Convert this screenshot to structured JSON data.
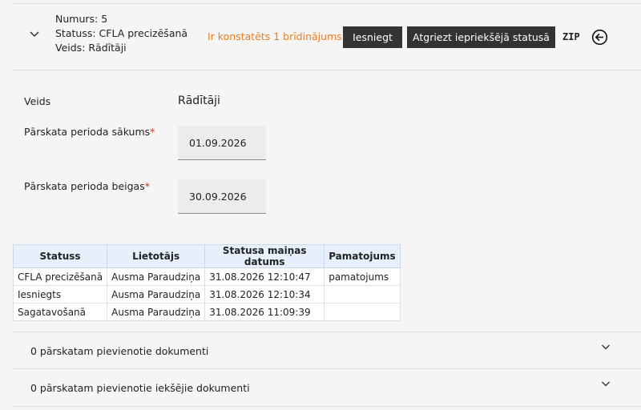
{
  "header": {
    "number": "Numurs: 5",
    "status": "Statuss: CFLA precizēšanā",
    "type": "Veids: Rādītāji",
    "warning": "Ir konstatēts 1 brīdinājums",
    "submit_label": "Iesniegt",
    "revert_label": "Atgriezt iepriekšējā statusā",
    "zip_label": "ZIP"
  },
  "form": {
    "type_label": "Veids",
    "type_value": "Rādītāji",
    "start_label": "Pārskata perioda sākums",
    "start_value": "01.09.2026",
    "end_label": "Pārskata perioda beigas",
    "end_value": "30.09.2026",
    "required_mark": "*"
  },
  "status_table": {
    "columns": [
      "Statuss",
      "Lietotājs",
      "Statusa maiņas datums",
      "Pamatojums"
    ],
    "rows": [
      [
        "CFLA precizēšanā",
        "Ausma Paraudziņa",
        "31.08.2026 12:10:47",
        "pamatojums"
      ],
      [
        "Iesniegts",
        "Ausma Paraudziņa",
        "31.08.2026 12:10:34",
        ""
      ],
      [
        "Sagatavošanā",
        "Ausma Paraudziņa",
        "31.08.2026 11:09:39",
        ""
      ]
    ]
  },
  "accordions": [
    {
      "label": "0 pārskatam pievienotie dokumenti"
    },
    {
      "label": "0 pārskatam pievienotie iekšējie dokumenti"
    }
  ],
  "colors": {
    "warning": "#f07c1a",
    "button_bg": "#333333",
    "table_header_bg": "#e6f0fb",
    "required": "#c0392b"
  },
  "icons": {
    "collapse": "chevron-down-icon",
    "back": "arrow-left-circle-icon",
    "accordion": "chevron-down-icon"
  }
}
